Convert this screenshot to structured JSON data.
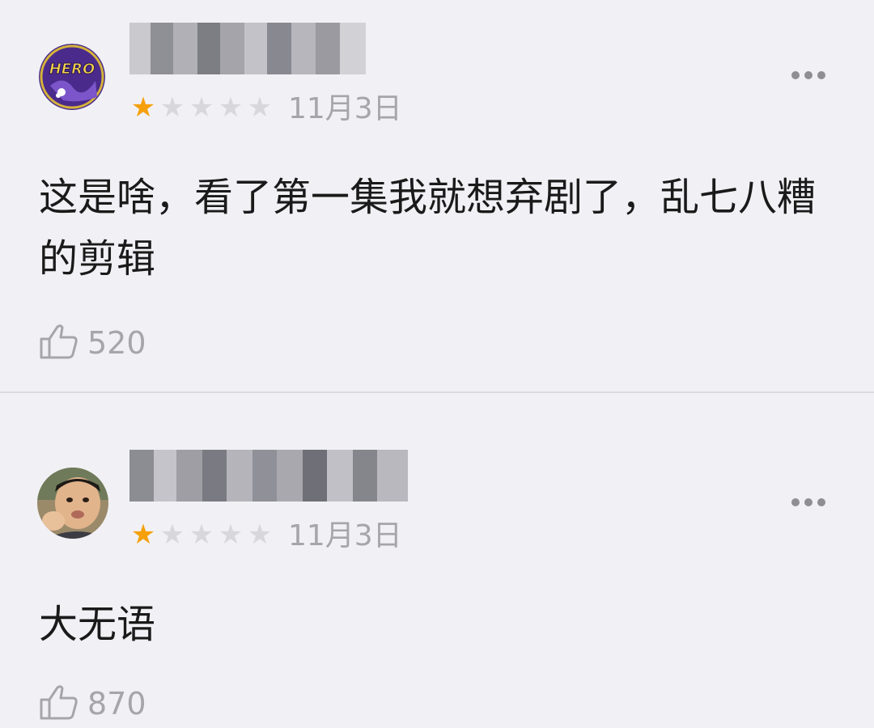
{
  "comments": [
    {
      "rating": 1,
      "max_rating": 5,
      "date": "11月3日",
      "text": "这是啥，看了第一集我就想弃剧了，乱七八糟的剪辑",
      "likes": "520",
      "avatar_text": "HERO"
    },
    {
      "rating": 1,
      "max_rating": 5,
      "date": "11月3日",
      "text": "大无语",
      "likes": "870"
    }
  ],
  "colors": {
    "background": "#f1f1f5",
    "star_filled": "#f5a00b",
    "star_empty": "#d8d8dc",
    "meta_text": "#a6a6aa",
    "body_text": "#1a1a1a",
    "hero_avatar_bg": "#4a2b8c"
  },
  "icons": {
    "more": "ellipsis-icon",
    "like": "thumbs-up-icon",
    "star": "star-icon"
  }
}
